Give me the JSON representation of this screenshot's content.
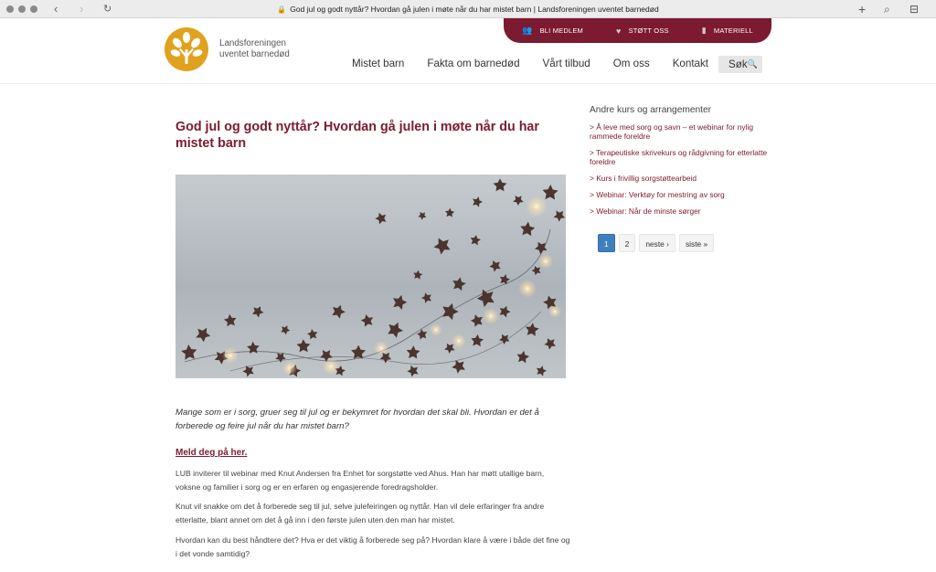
{
  "browser": {
    "url_title": "God jul og godt nyttår? Hvordan gå julen i møte når du har mistet barn | Landsforeningen uventet barnedød",
    "back_icon": "‹",
    "forward_icon": "›",
    "reload_icon": "↻",
    "new_tab_icon": "+",
    "search_icon": "⌕",
    "sidebar_icon": "⊟",
    "lock_icon": "🔒"
  },
  "topbar": {
    "member_label": "BLI MEDLEM",
    "support_label": "STØTT OSS",
    "material_label": "MATERIELL"
  },
  "brand": {
    "line1": "Landsforeningen",
    "line2": "uventet barnedød"
  },
  "nav": {
    "items": [
      "Mistet barn",
      "Fakta om barnedød",
      "Vårt tilbud",
      "Om oss",
      "Kontakt"
    ],
    "search_label": "Søk"
  },
  "article": {
    "title": "God jul og godt nyttår? Hvordan gå julen i møte når du har mistet barn",
    "lead": "Mange som er i sorg, gruer seg til jul og er bekymret for hvordan det skal bli. Hvordan er det å forberede og feire jul når du har mistet barn?",
    "signup": "Meld deg på her.",
    "paragraphs": [
      "LUB inviterer til webinar med Knut Andersen fra Enhet for sorgstøtte ved Ahus. Han har møtt utallige barn, voksne og familier i sorg og er en erfaren og engasjerende foredragsholder.",
      "Knut vil snakke om det å forberede seg til jul, selve julefeiringen og nyttår. Han vil dele erfaringer fra andre etterlatte, blant annet om det å gå inn i den første julen uten den man har mistet.",
      "Hvordan kan du best håndtere det? Hva er det viktig å forberede seg på? Hvordan klare å være i både det fine og i det vonde samtidig?"
    ]
  },
  "sidebar": {
    "title": "Andre kurs og arrangementer",
    "items": [
      "> Å leve med sorg og savn – et webinar for nylig rammede foreldre",
      "> Terapeutiske skrivekurs og rådgivning for etterlatte foreldre",
      "> Kurs i frivillig sorgstøttearbeid",
      "> Webinar: Verktøy for mestring av sorg",
      "> Webinar: Når de minste sørger"
    ],
    "pager": [
      "1",
      "2",
      "neste ›",
      "siste »"
    ]
  },
  "colors": {
    "brand": "#7b1a30",
    "logo": "#e0a21e",
    "pager_active": "#3f7fc0"
  }
}
